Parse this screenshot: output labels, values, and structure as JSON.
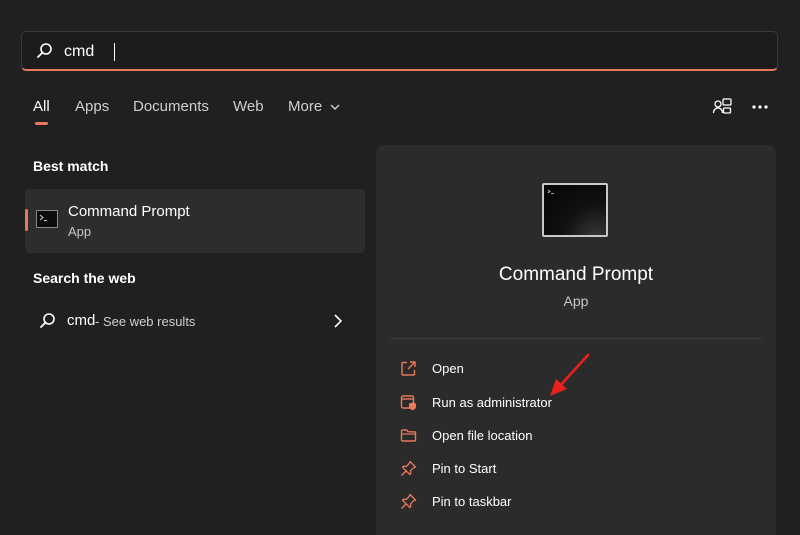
{
  "search": {
    "value": "cmd"
  },
  "tabs": [
    {
      "label": "All",
      "active": true
    },
    {
      "label": "Apps"
    },
    {
      "label": "Documents"
    },
    {
      "label": "Web"
    },
    {
      "label": "More"
    }
  ],
  "toolbar": {
    "icons": [
      "share-device-icon",
      "more-icon"
    ]
  },
  "best_match": {
    "heading": "Best match",
    "item": {
      "title": "Command Prompt",
      "subtitle": "App",
      "icon": "command-prompt-icon"
    }
  },
  "search_web": {
    "heading": "Search the web",
    "item": {
      "query": "cmd",
      "suffix": "- See web results"
    }
  },
  "details": {
    "title": "Command Prompt",
    "subtitle": "App",
    "actions": [
      {
        "label": "Open",
        "icon": "open-icon"
      },
      {
        "label": "Run as administrator",
        "icon": "run-admin-icon"
      },
      {
        "label": "Open file location",
        "icon": "folder-icon"
      },
      {
        "label": "Pin to Start",
        "icon": "pin-icon"
      },
      {
        "label": "Pin to taskbar",
        "icon": "pin-icon"
      }
    ]
  },
  "colors": {
    "accent": "#e8795b",
    "background": "#202020",
    "panel": "#2b2b2b",
    "annotation": "#e8221b"
  }
}
